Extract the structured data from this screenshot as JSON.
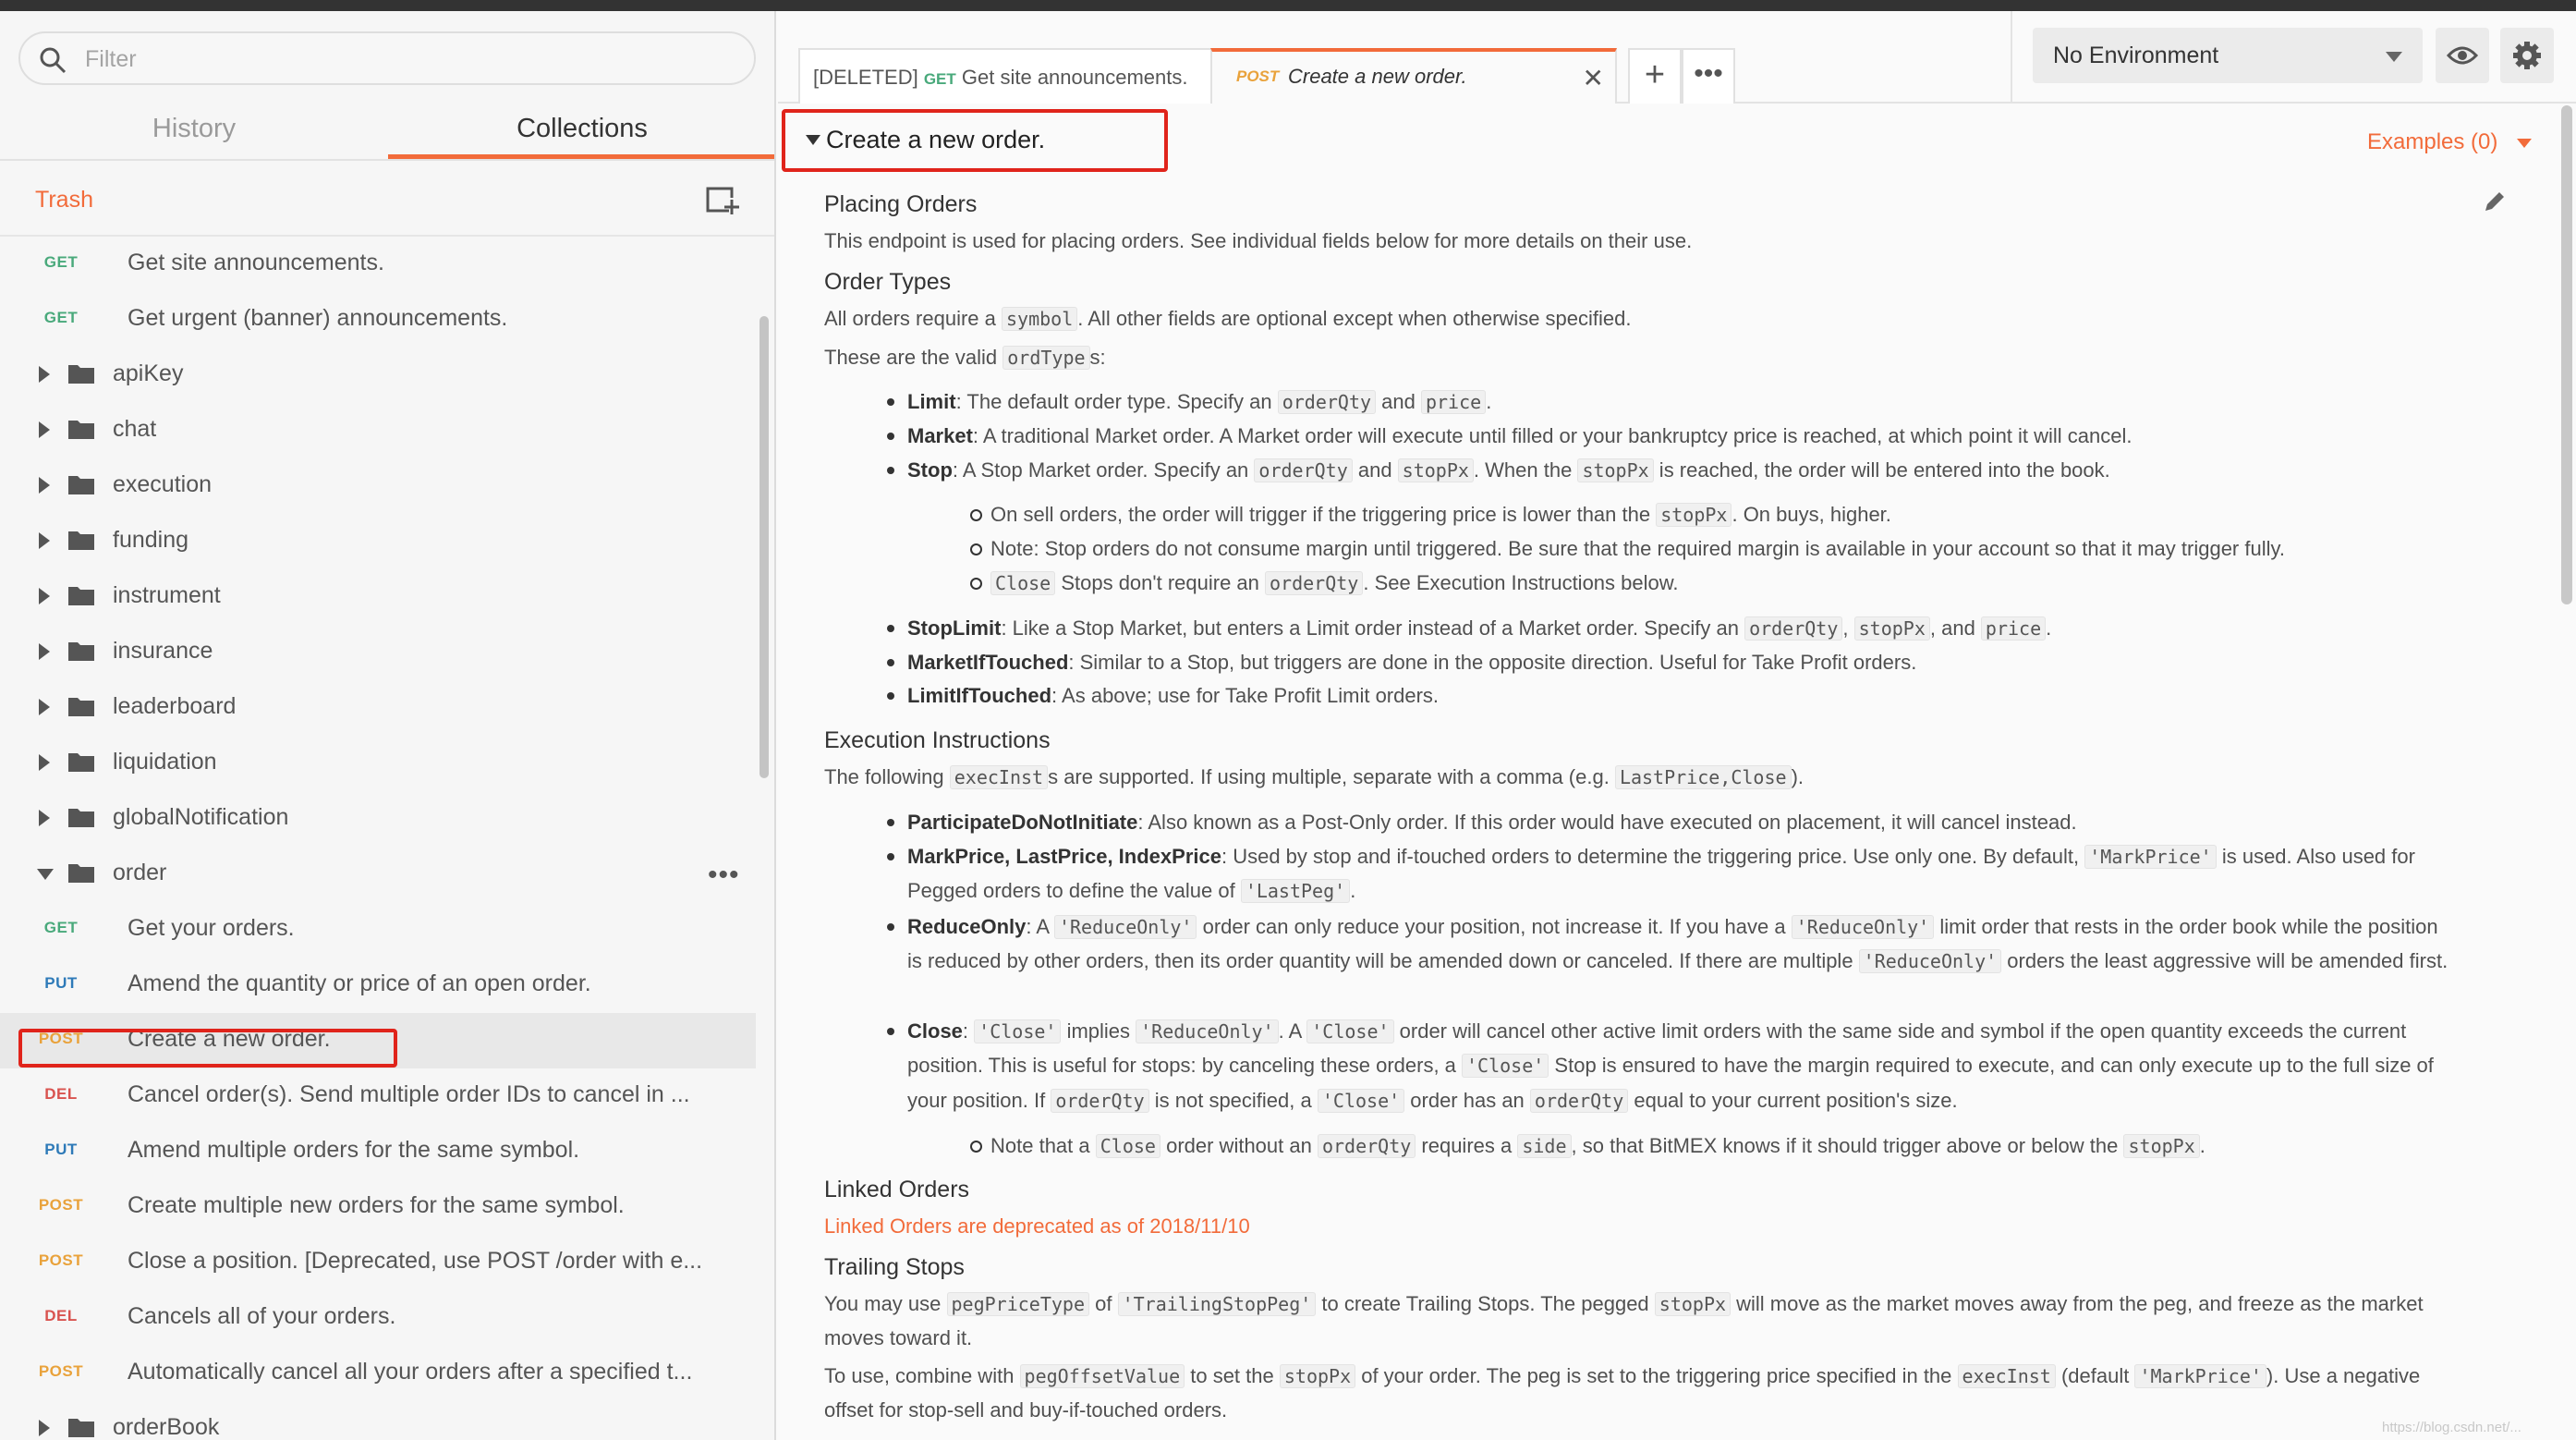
{
  "sidebar": {
    "filter_placeholder": "Filter",
    "tabs": [
      "History",
      "Collections"
    ],
    "trash_label": "Trash",
    "items": [
      {
        "type": "request",
        "method": "GET",
        "label": "Get site announcements."
      },
      {
        "type": "request",
        "method": "GET",
        "label": "Get urgent (banner) announcements."
      },
      {
        "type": "folder",
        "label": "apiKey"
      },
      {
        "type": "folder",
        "label": "chat"
      },
      {
        "type": "folder",
        "label": "execution"
      },
      {
        "type": "folder",
        "label": "funding"
      },
      {
        "type": "folder",
        "label": "instrument"
      },
      {
        "type": "folder",
        "label": "insurance"
      },
      {
        "type": "folder",
        "label": "leaderboard"
      },
      {
        "type": "folder",
        "label": "liquidation"
      },
      {
        "type": "folder",
        "label": "globalNotification"
      },
      {
        "type": "folder",
        "label": "order",
        "open": true
      },
      {
        "type": "request",
        "method": "GET",
        "label": "Get your orders."
      },
      {
        "type": "request",
        "method": "PUT",
        "label": "Amend the quantity or price of an open order."
      },
      {
        "type": "request",
        "method": "POST",
        "label": "Create a new order.",
        "selected": true
      },
      {
        "type": "request",
        "method": "DEL",
        "label": "Cancel order(s). Send multiple order IDs to cancel in ..."
      },
      {
        "type": "request",
        "method": "PUT",
        "label": "Amend multiple orders for the same symbol."
      },
      {
        "type": "request",
        "method": "POST",
        "label": "Create multiple new orders for the same symbol."
      },
      {
        "type": "request",
        "method": "POST",
        "label": "Close a position. [Deprecated, use POST /order with e..."
      },
      {
        "type": "request",
        "method": "DEL",
        "label": "Cancels all of your orders."
      },
      {
        "type": "request",
        "method": "POST",
        "label": "Automatically cancel all your orders after a specified t..."
      },
      {
        "type": "folder",
        "label": "orderBook"
      }
    ]
  },
  "header": {
    "tab1": {
      "prefix": "[DELETED]",
      "method": "GET",
      "label": "Get site announcements."
    },
    "tab2": {
      "method": "POST",
      "label": "Create a new order."
    },
    "environment": "No Environment"
  },
  "main": {
    "title": "Create a new order.",
    "examples": "Examples (0)",
    "placing_orders_heading": "Placing Orders",
    "placing_orders_text": "This endpoint is used for placing orders. See individual fields below for more details on their use.",
    "order_types_heading": "Order Types",
    "order_types_p1_a": "All orders require a",
    "order_types_p1_code": "symbol",
    "order_types_p1_b": ". All other fields are optional except when otherwise specified.",
    "order_types_p2_a": "These are the valid",
    "order_types_p2_code": "ordType",
    "order_types_p2_b": "s:",
    "execution_heading": "Execution Instructions",
    "linked_heading": "Linked Orders",
    "linked_deprecated": "Linked Orders are deprecated as of 2018/11/10",
    "trailing_heading": "Trailing Stops"
  },
  "colors": {
    "accent": "#f26b3a",
    "highlight": "#e0241b",
    "get": "#49a97b",
    "put": "#2e7ab8",
    "post": "#e9a23b",
    "del": "#d9534f"
  },
  "watermark": "https://blog.csdn.net/..."
}
